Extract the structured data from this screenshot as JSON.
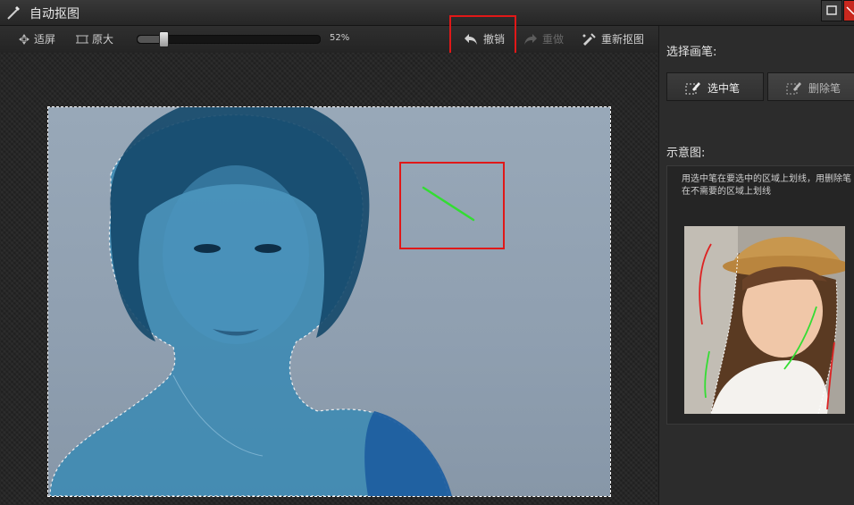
{
  "window": {
    "title": "自动抠图"
  },
  "toolbar": {
    "fit_label": "适屏",
    "original_label": "原大",
    "zoom_value": 0.52,
    "zoom_text": "52%",
    "undo_label": "撤销",
    "redo_label": "重做",
    "reset_label": "重新抠图"
  },
  "panel": {
    "pen_heading": "选择画笔:",
    "select_pen_label": "选中笔",
    "erase_pen_label": "删除笔",
    "demo_heading": "示意图:",
    "demo_text": "用选中笔在要选中的区域上划线，用删除笔在不需要的区域上划线"
  },
  "colors": {
    "highlight": "#e01818",
    "select_stroke": "#33dd33",
    "erase_stroke": "#dd2222",
    "mask_tint": "#1e6a9a"
  },
  "icons": {
    "app": "magic-wand-icon",
    "fit": "fit-screen-icon",
    "original": "original-size-icon",
    "undo": "undo-icon",
    "redo": "redo-icon",
    "reset": "reset-cutout-icon",
    "select_pen": "select-pen-icon",
    "erase_pen": "erase-pen-icon"
  }
}
